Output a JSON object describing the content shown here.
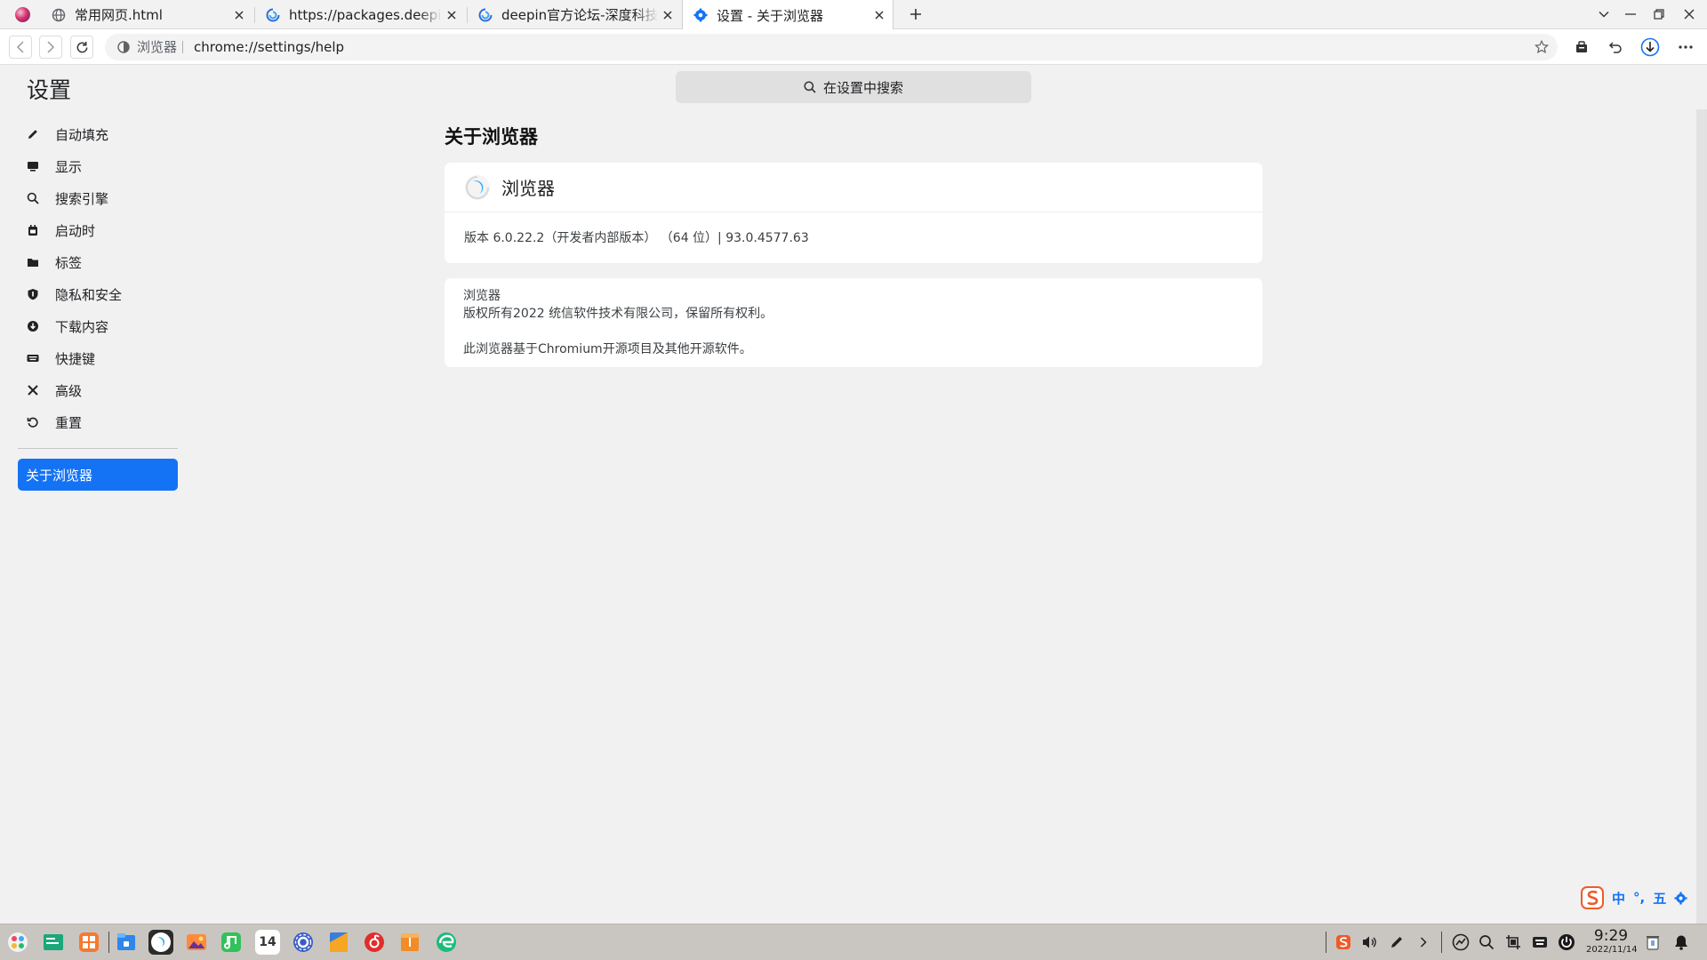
{
  "tabs": [
    {
      "title": "常用网页.html",
      "active": false
    },
    {
      "title": "https://packages.deepin.com",
      "active": false
    },
    {
      "title": "deepin官方论坛-深度科技官方论坛",
      "active": false
    },
    {
      "title": "设置 - 关于浏览器",
      "active": true
    }
  ],
  "toolbar": {
    "site_chip": "浏览器",
    "url": "chrome://settings/help"
  },
  "settings": {
    "title": "设置",
    "search_placeholder": "在设置中搜索",
    "sidebar": [
      {
        "label": "自动填充",
        "icon": "pencil-icon"
      },
      {
        "label": "显示",
        "icon": "display-icon"
      },
      {
        "label": "搜索引擎",
        "icon": "search-icon"
      },
      {
        "label": "启动时",
        "icon": "startup-icon"
      },
      {
        "label": "标签",
        "icon": "folder-icon"
      },
      {
        "label": "隐私和安全",
        "icon": "shield-icon"
      },
      {
        "label": "下载内容",
        "icon": "download-icon"
      },
      {
        "label": "快捷键",
        "icon": "keyboard-icon"
      },
      {
        "label": "高级",
        "icon": "tools-icon"
      },
      {
        "label": "重置",
        "icon": "reset-icon"
      }
    ],
    "about_item": "关于浏览器"
  },
  "about": {
    "section_title": "关于浏览器",
    "product_name": "浏览器",
    "version": "版本 6.0.22.2（开发者内部版本）  （64 位）| 93.0.4577.63",
    "legal_name": "浏览器",
    "copyright": "版权所有2022 统信软件技术有限公司，保留所有权利。",
    "credits": "此浏览器基于Chromium开源项目及其他开源软件。"
  },
  "ime": {
    "mode": "中",
    "punct": "°,",
    "layout": "五"
  },
  "clock": {
    "time": "9:29",
    "date": "2022/11/14"
  },
  "dock": {
    "calendar_day": "14"
  },
  "colors": {
    "accent": "#1473f5",
    "page_bg": "#f1f1f1",
    "card_bg": "#ffffff"
  }
}
